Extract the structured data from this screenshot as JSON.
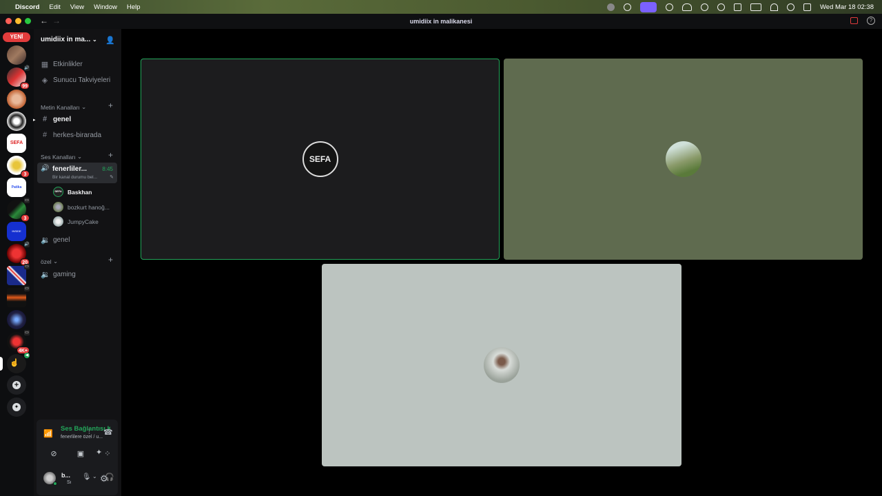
{
  "menubar": {
    "app": "Discord",
    "items": [
      "Edit",
      "View",
      "Window",
      "Help"
    ],
    "datetime": "Wed Mar 18  02:38"
  },
  "window": {
    "title": "umidiix in malikanesi"
  },
  "servers": {
    "new_label": "YENİ",
    "badges": [
      "99",
      "3",
      "3",
      "20",
      "4K+"
    ]
  },
  "sidebar": {
    "server_name": "umidiix in ma...",
    "nav": [
      {
        "label": "Etkinlikler",
        "icon": "calendar-icon"
      },
      {
        "label": "Sunucu Takviyeleri",
        "icon": "boost-icon"
      }
    ],
    "text_category": "Metin Kanalları",
    "text_channels": [
      "genel",
      "herkes-birarada"
    ],
    "voice_category": "Ses Kanalları",
    "active_voice": {
      "name": "fenerliler...",
      "time": "8:45",
      "status": "Bir kanal durumu bel..."
    },
    "voice_users": [
      "Baskhan",
      "bozkurt hanoğ...",
      "JumpyCake"
    ],
    "voice_channels_more": [
      "genel"
    ],
    "private_category": "özel",
    "private_channels": [
      "gaming"
    ]
  },
  "voice": {
    "status": "Ses Bağlantısı K",
    "location": "fenerlilere özel / u..."
  },
  "user": {
    "name": "b...",
    "sub": "Sı"
  },
  "stream": {
    "tiles": [
      {
        "avatar_text": "SEFA",
        "bg": "#1c1c1e",
        "speaking": true
      },
      {
        "avatar_text": "",
        "bg": "#5f6b4f",
        "speaking": false
      },
      {
        "avatar_text": "",
        "bg": "#bcc4c0",
        "speaking": false
      }
    ]
  },
  "colors": {
    "accent_green": "#23a55a",
    "badge_red": "#e23c3c",
    "menu_active": "#7b61ff"
  }
}
